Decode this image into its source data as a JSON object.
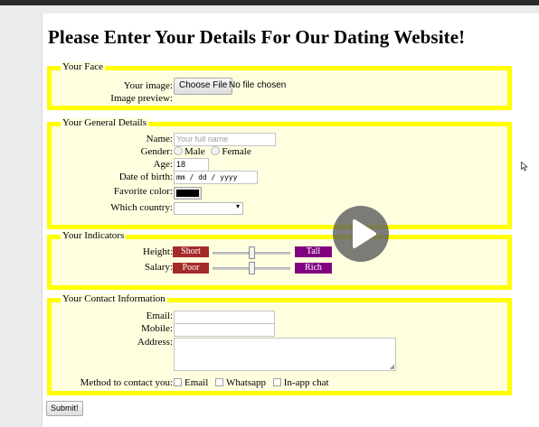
{
  "page": {
    "heading": "Please Enter Your Details For Our Dating Website!",
    "submit_label": "Submit!"
  },
  "face": {
    "legend": "Your Face",
    "image_label": "Your image:",
    "file_button": "Choose File",
    "file_status": "No file chosen",
    "preview_label": "Image preview:"
  },
  "general": {
    "legend": "Your General Details",
    "name_label": "Name:",
    "name_placeholder": "Your full name",
    "gender_label": "Gender:",
    "gender_options": [
      "Male",
      "Female"
    ],
    "age_label": "Age:",
    "age_value": "18",
    "dob_label": "Date of birth:",
    "dob_value": "mm / dd / yyyy",
    "color_label": "Favorite color:",
    "color_value": "#000000",
    "country_label": "Which country:",
    "country_value": ""
  },
  "indicators": {
    "legend": "Your Indicators",
    "height": {
      "label": "Height:",
      "min_tag": "Short",
      "max_tag": "Tall",
      "value_fraction": 0.5
    },
    "salary": {
      "label": "Salary:",
      "min_tag": "Poor",
      "max_tag": "Rich",
      "value_fraction": 0.5
    },
    "min_tag_color": "#a52a2a",
    "max_tag_color": "#800080"
  },
  "contact": {
    "legend": "Your Contact Information",
    "email_label": "Email:",
    "mobile_label": "Mobile:",
    "address_label": "Address:",
    "method_label": "Method to contact you:",
    "methods": [
      "Email",
      "Whatsapp",
      "In-app chat"
    ]
  },
  "overlay": {
    "icon": "play-icon"
  },
  "colors": {
    "fieldset_border": "#ffff00",
    "fieldset_background": "#ffffe0"
  }
}
